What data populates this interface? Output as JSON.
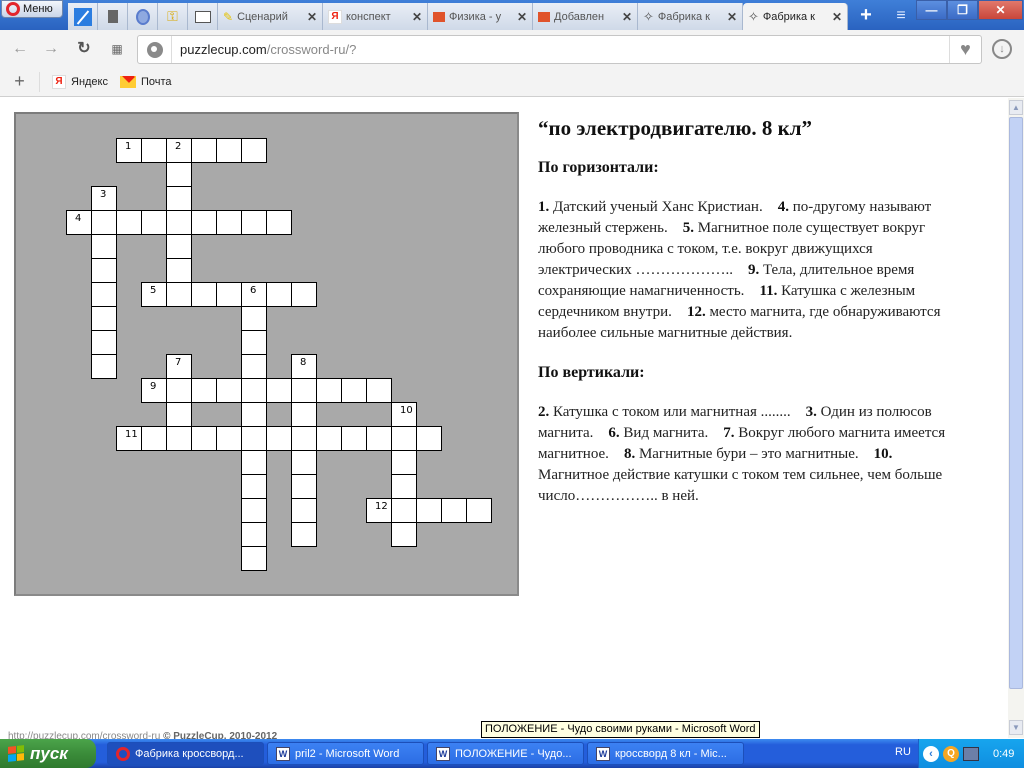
{
  "browser": {
    "menu_label": "Меню",
    "pinned_tabs": [
      {
        "icon": "speed-dial-icon"
      },
      {
        "icon": "page-icon"
      },
      {
        "icon": "vk-icon"
      },
      {
        "icon": "key-icon"
      },
      {
        "icon": "presentation-icon"
      }
    ],
    "tabs": [
      {
        "title": "Сценарий",
        "icon": "pencil-icon",
        "active": false
      },
      {
        "title": "конспект",
        "icon": "yandex-icon",
        "active": false
      },
      {
        "title": "Физика - у",
        "icon": "briefcase-icon",
        "active": false
      },
      {
        "title": "Добавлен",
        "icon": "briefcase-icon",
        "active": false
      },
      {
        "title": "Фабрика к",
        "icon": "magic-wand-icon",
        "active": false
      },
      {
        "title": "Фабрика к",
        "icon": "magic-wand-icon",
        "active": true
      }
    ],
    "url_host": "puzzlecup.com",
    "url_path": "/crossword-ru/?",
    "bookmarks": [
      {
        "label": "Яндекс",
        "icon": "yandex-icon"
      },
      {
        "label": "Почта",
        "icon": "mail-icon"
      }
    ]
  },
  "crossword": {
    "cells_color": "#ffffff",
    "panel_color": "#a9a9a9",
    "words": [
      {
        "num": "1",
        "dir": "across",
        "row": 0,
        "col": 2,
        "len": 6
      },
      {
        "num": "2",
        "dir": "down",
        "row": 0,
        "col": 4,
        "len": 7
      },
      {
        "num": "3",
        "dir": "down",
        "row": 2,
        "col": 1,
        "len": 8
      },
      {
        "num": "4",
        "dir": "across",
        "row": 3,
        "col": 0,
        "len": 9
      },
      {
        "num": "5",
        "dir": "across",
        "row": 6,
        "col": 3,
        "len": 7
      },
      {
        "num": "6",
        "dir": "down",
        "row": 6,
        "col": 7,
        "len": 12
      },
      {
        "num": "7",
        "dir": "down",
        "row": 9,
        "col": 4,
        "len": 3
      },
      {
        "num": "8",
        "dir": "down",
        "row": 9,
        "col": 9,
        "len": 8
      },
      {
        "num": "9",
        "dir": "across",
        "row": 10,
        "col": 3,
        "len": 10
      },
      {
        "num": "10",
        "dir": "down",
        "row": 11,
        "col": 13,
        "len": 6
      },
      {
        "num": "11",
        "dir": "across",
        "row": 12,
        "col": 2,
        "len": 13
      },
      {
        "num": "12",
        "dir": "across",
        "row": 15,
        "col": 12,
        "len": 5
      }
    ]
  },
  "clues": {
    "title": "“по электродвигателю. 8 кл”",
    "across_heading": "По горизонтали:",
    "across": [
      {
        "num": "1.",
        "text": "Датский ученый Ханс Кристиан."
      },
      {
        "num": "4.",
        "text": "по-другому называют железный стержень."
      },
      {
        "num": "5.",
        "text": "Магнитное поле существует вокруг любого проводника с током, т.е. вокруг движущихся электрических ……………….."
      },
      {
        "num": "9.",
        "text": "Тела, длительное время сохраняющие намагниченность."
      },
      {
        "num": "11.",
        "text": "Катушка с железным сердечником внутри."
      },
      {
        "num": "12.",
        "text": "место магнита, где обнаруживаются наиболее сильные магнитные действия."
      }
    ],
    "down_heading": "По вертикали:",
    "down": [
      {
        "num": "2.",
        "text": "Катушка с током или магнитная ........"
      },
      {
        "num": "3.",
        "text": "Один из полюсов магнита."
      },
      {
        "num": "6.",
        "text": "Вид магнита."
      },
      {
        "num": "7.",
        "text": "Вокруг любого магнита имеется магнитное."
      },
      {
        "num": "8.",
        "text": "Магнитные бури – это магнитные."
      },
      {
        "num": "10.",
        "text": "Магнитное действие катушки с током тем сильнее, чем больше число…………….. в ней."
      }
    ]
  },
  "footer": {
    "link": "http://puzzlecup.com/crossword-ru",
    "copyright": "© PuzzleCup, 2010-2012"
  },
  "tooltip": "ПОЛОЖЕНИЕ - Чудо своими руками - Microsoft Word",
  "taskbar": {
    "start_label": "пуск",
    "items": [
      {
        "label": "Фабрика кроссворд...",
        "icon": "opera-icon",
        "active": true
      },
      {
        "label": "pril2 - Microsoft Word",
        "icon": "word-icon",
        "active": false
      },
      {
        "label": "ПОЛОЖЕНИЕ - Чудо...",
        "icon": "word-icon",
        "active": false
      },
      {
        "label": "кроссворд 8 кл - Mic...",
        "icon": "word-icon",
        "active": false
      }
    ],
    "language": "RU",
    "clock": "0:49"
  }
}
